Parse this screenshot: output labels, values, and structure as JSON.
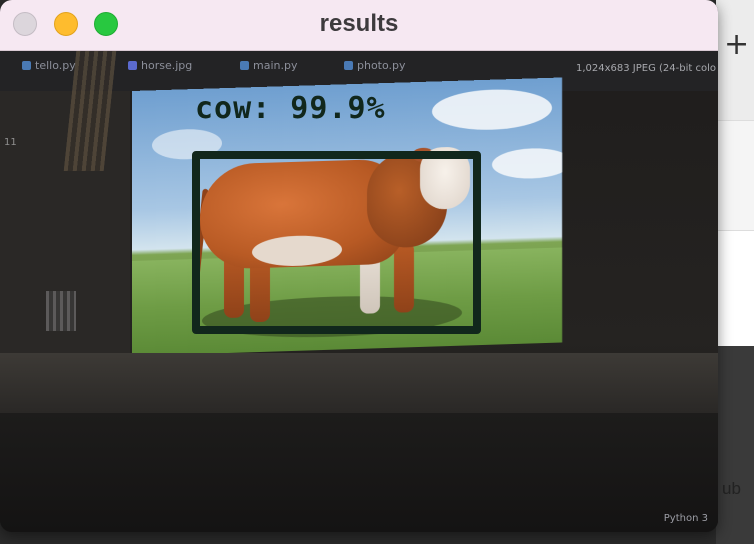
{
  "window": {
    "title": "results"
  },
  "screen": {
    "tabs": [
      {
        "label": "tello.py",
        "color": "#4a7ab5"
      },
      {
        "label": "horse.jpg",
        "color": "#5b6acf"
      },
      {
        "label": "main.py",
        "color": "#4a7ab5"
      },
      {
        "label": "photo.py",
        "color": "#4a7ab5"
      }
    ],
    "image_meta": "1,024x683 JPEG (24-bit colo",
    "status": "Python 3",
    "line_label": "11"
  },
  "detection": {
    "label": "cow: 99.9%",
    "class": "cow",
    "confidence": 99.9,
    "box_color": "#11271c"
  },
  "background_window": {
    "plus_glyph": "+",
    "github_icon": "github-icon",
    "text_peek": "ub"
  }
}
